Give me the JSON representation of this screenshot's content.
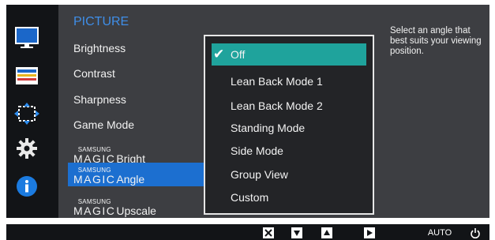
{
  "colors": {
    "title_blue": "#3f8ee8",
    "selected_blue": "#1c6fd0",
    "submenu_teal": "#1fa39c",
    "panel_dark": "#3d3e42",
    "icon_bg": "#121417"
  },
  "sidebar": {
    "icons": [
      "picture-icon",
      "color-icon",
      "size-position-icon",
      "settings-gear-icon",
      "info-icon"
    ]
  },
  "menu": {
    "title": "PICTURE",
    "items": [
      {
        "label": "Brightness"
      },
      {
        "label": "Contrast"
      },
      {
        "label": "Sharpness"
      },
      {
        "label": "Game Mode"
      },
      {
        "brand_small": "SAMSUNG",
        "brand_big": "MAGIC",
        "word": "Bright"
      },
      {
        "brand_small": "SAMSUNG",
        "brand_big": "MAGIC",
        "word": "Angle",
        "selected": true
      },
      {
        "brand_small": "SAMSUNG",
        "brand_big": "MAGIC",
        "word": "Upscale"
      }
    ]
  },
  "submenu": {
    "selected_index": 0,
    "items": [
      "Off",
      "Lean Back Mode 1",
      "Lean Back Mode 2",
      "Standing Mode",
      "Side Mode",
      "Group View",
      "Custom"
    ]
  },
  "help": {
    "text": "Select an angle that best suits your viewing position."
  },
  "buttons": [
    {
      "icon": "close-icon"
    },
    {
      "icon": "arrow-down-icon"
    },
    {
      "icon": "arrow-up-icon"
    },
    {
      "icon": "arrow-right-icon"
    },
    {
      "label": "AUTO"
    },
    {
      "icon": "power-icon"
    }
  ]
}
